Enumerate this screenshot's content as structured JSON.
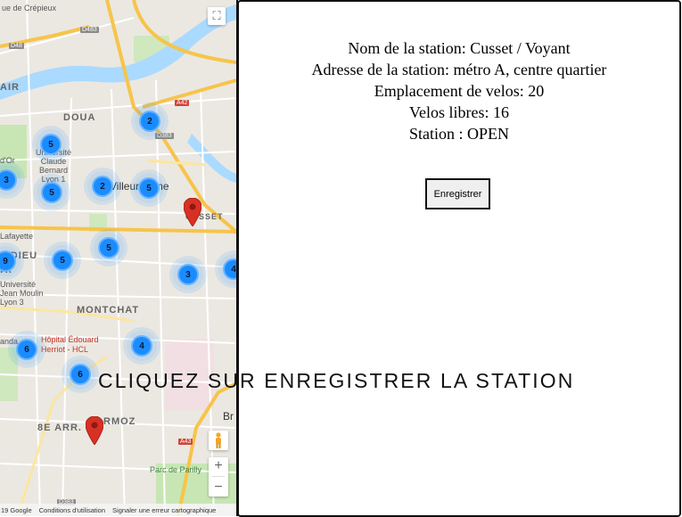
{
  "map": {
    "clusters": [
      {
        "id": "c1",
        "count": "2"
      },
      {
        "id": "c2",
        "count": "5"
      },
      {
        "id": "c3",
        "count": "3"
      },
      {
        "id": "c4",
        "count": "5"
      },
      {
        "id": "c5",
        "count": "2"
      },
      {
        "id": "c6",
        "count": "5"
      },
      {
        "id": "c7",
        "count": "5"
      },
      {
        "id": "c8",
        "count": "9"
      },
      {
        "id": "c9",
        "count": "5"
      },
      {
        "id": "c10",
        "count": "3"
      },
      {
        "id": "c11",
        "count": "4"
      },
      {
        "id": "c12",
        "count": "6"
      },
      {
        "id": "c13",
        "count": "4"
      },
      {
        "id": "c14",
        "count": "6"
      }
    ],
    "places": {
      "crepieux": "ue de Crépieux",
      "douai": "DOUA",
      "air": "AIR",
      "claude_bernard": "Université\nClaude\nBernard\nLyon 1",
      "villeurbanne": "Villeurbanne",
      "cusset": "CUSSET",
      "dieu": "T-DIEU",
      "arr": "R.",
      "moulin": "Université\nJean Moulin\nLyon 3",
      "montchat": "MONTCHAT",
      "hopital": "Hôpital Édouard\nHerriot - HCL",
      "arr8": "8E ARR.",
      "armoz": "RMOZ",
      "parilly": "Parc de Parilly",
      "bron": "Br",
      "lafayette": "Lafayette",
      "dor": "d'Or",
      "randa": "anda"
    },
    "road_badges": {
      "d483": "D483",
      "d48": "D48",
      "a42": "A42",
      "d383a": "D383",
      "d383b": "D383",
      "a43": "A43"
    },
    "controls": {
      "fullscreen_icon": "⛶",
      "zoom_in": "+",
      "zoom_out": "−"
    },
    "footer": {
      "copyright": "19 Google",
      "terms": "Conditions d'utilisation",
      "report": "Signaler une erreur cartographique"
    }
  },
  "station": {
    "name_line": "Nom de la station: Cusset / Voyant",
    "address_line": "Adresse de la station: métro A, centre quartier",
    "slots_line": "Emplacement de velos: 20",
    "free_line": "Velos libres: 16",
    "status_line": "Station : OPEN"
  },
  "actions": {
    "save_label": "Enregistrer"
  },
  "prompt": {
    "text": "CLIQUEZ SUR ENREGISTRER LA STATION"
  },
  "colors": {
    "cluster_blue": "#1a8cff",
    "marker_red": "#d93025",
    "water": "#aadaff",
    "highway": "#f7c44a"
  }
}
